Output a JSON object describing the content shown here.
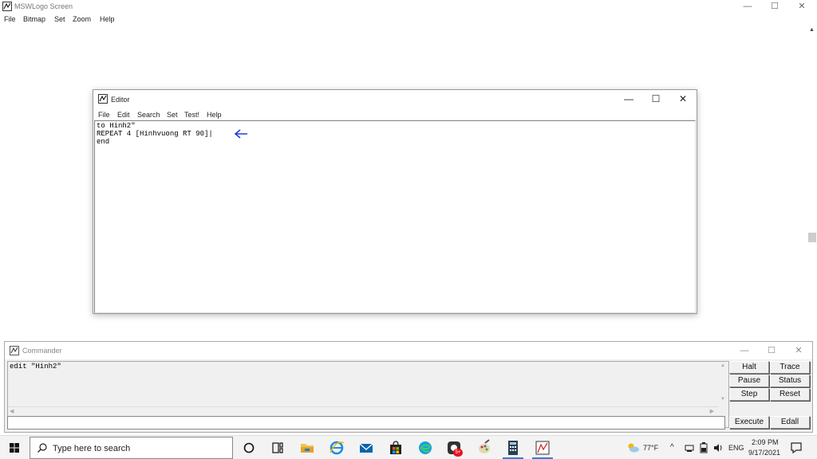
{
  "main_window": {
    "title": "MSWLogo Screen",
    "menu": [
      "File",
      "Bitmap",
      "Set",
      "Zoom",
      "Help"
    ],
    "controls": {
      "minimize": "—",
      "maximize": "☐",
      "close": "✕"
    }
  },
  "editor": {
    "title": "Editor",
    "menu": [
      "File",
      "Edit",
      "Search",
      "Set",
      "Test!",
      "Help"
    ],
    "controls": {
      "minimize": "—",
      "maximize": "☐",
      "close": "✕"
    },
    "content": "to Hinh2\"\nREPEAT 4 [Hinhvuong RT 90]|\nend",
    "arrow_color": "#1f3fd1"
  },
  "commander": {
    "title": "Commander",
    "controls": {
      "minimize": "—",
      "maximize": "☐",
      "close": "✕"
    },
    "history_text": "edit \"Hinh2\"",
    "input_value": "",
    "buttons": {
      "halt": "Halt",
      "trace": "Trace",
      "pause": "Pause",
      "status": "Status",
      "step": "Step",
      "reset": "Reset",
      "execute": "Execute",
      "edall": "Edall"
    }
  },
  "taskbar": {
    "search_placeholder": "Type here to search",
    "weather": "77°F",
    "language": "ENG",
    "time": "2:09 PM",
    "date": "9/17/2021",
    "store_badge": "5+",
    "accent": "#3a7bd5"
  }
}
